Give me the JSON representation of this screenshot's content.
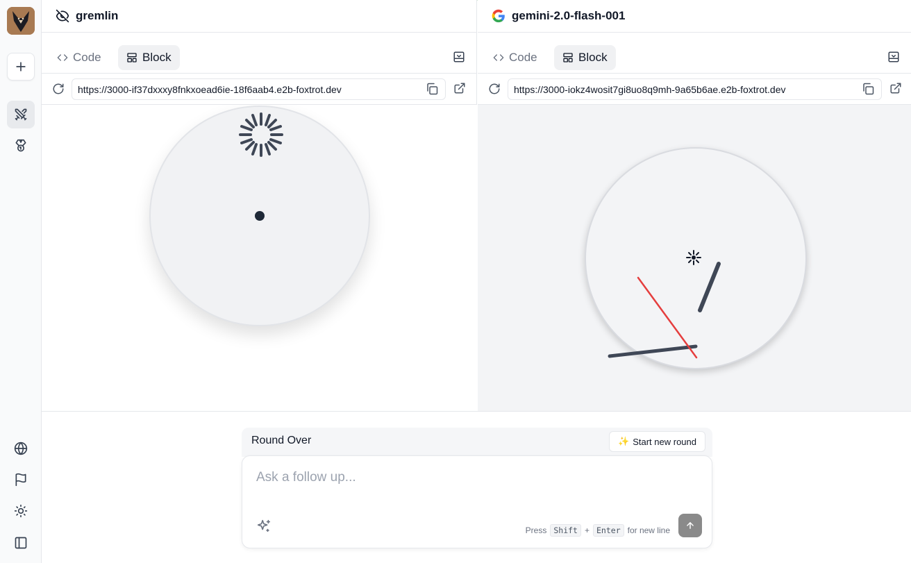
{
  "sidebar": {
    "logo": "gremlin-fox-logo",
    "items": [
      {
        "name": "new-chat",
        "icon": "plus-icon"
      },
      {
        "name": "arena",
        "icon": "crossed-swords-icon",
        "active": true
      },
      {
        "name": "leaderboard",
        "icon": "medal-icon"
      },
      {
        "name": "language",
        "icon": "globe-icon"
      },
      {
        "name": "report",
        "icon": "flag-icon"
      },
      {
        "name": "theme",
        "icon": "sun-icon"
      },
      {
        "name": "toggle-sidebar",
        "icon": "sidebar-panel-icon"
      }
    ]
  },
  "panels": [
    {
      "model_name": "gremlin",
      "model_icon": "eye-off-icon",
      "tabs": {
        "code": "Code",
        "block": "Block",
        "active": "Block"
      },
      "url": "https://3000-if37dxxxy8fnkxoead6ie-18f6aab4.e2b-foxtrot.dev"
    },
    {
      "model_name": "gemini-2.0-flash-001",
      "model_icon": "google-g-icon",
      "tabs": {
        "code": "Code",
        "block": "Block",
        "active": "Block"
      },
      "url": "https://3000-iokz4wosit7gi8uo8q9mh-9a65b6ae.e2b-foxtrot.dev"
    }
  ],
  "round": {
    "status": "Round Over",
    "new_round_label": "Start new round",
    "new_round_emoji": "✨"
  },
  "composer": {
    "placeholder": "Ask a follow up...",
    "hint_press": "Press",
    "hint_key1": "Shift",
    "hint_plus": "+",
    "hint_key2": "Enter",
    "hint_suffix": "for new line"
  },
  "colors": {
    "accent_dark": "#3f4756",
    "second_hand": "#e53e3e",
    "send_button": "#8a8a8a"
  }
}
